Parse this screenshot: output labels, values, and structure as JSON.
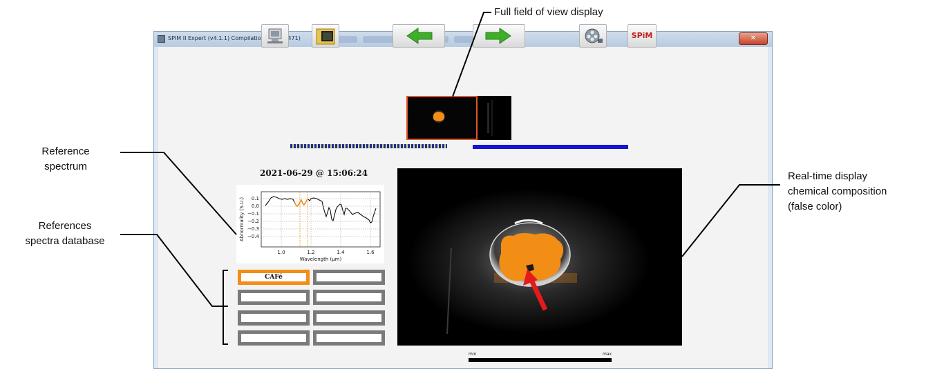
{
  "window": {
    "title": "SPIM II Expert  (v4.1.1) Compilation: 471 (b 471)",
    "close_glyph": "✕"
  },
  "toolbar": {
    "buttons": [
      {
        "name": "acquisition-icon"
      },
      {
        "name": "open-folder-icon"
      },
      {
        "name": "arrow-left-icon",
        "color": "#3fae29"
      },
      {
        "name": "arrow-right-icon",
        "color": "#3fae29"
      },
      {
        "name": "film-reel-icon"
      },
      {
        "name": "spim-logo",
        "label": "SPiM"
      }
    ]
  },
  "acquisition": {
    "timestamp": "2021-06-29 @ 15:06:24"
  },
  "spectrum_plot": {
    "ylabel": "Abnormality (S.U.)",
    "xlabel": "Wavelength (μm)",
    "yticks": [
      "0.1",
      "0.0",
      "−0.1",
      "−0.2",
      "−0.3",
      "−0.4"
    ],
    "xticks": [
      "1.0",
      "1.2",
      "1.4",
      "1.6"
    ]
  },
  "references": {
    "cells": [
      {
        "label": "CAFé",
        "active": true
      },
      {
        "label": "",
        "active": false
      },
      {
        "label": "",
        "active": false
      },
      {
        "label": "",
        "active": false
      },
      {
        "label": "",
        "active": false
      },
      {
        "label": "",
        "active": false
      },
      {
        "label": "",
        "active": false
      },
      {
        "label": "",
        "active": false
      }
    ]
  },
  "scale": {
    "min": "min",
    "max": "max"
  },
  "annotations": {
    "full_field": "Full field of view display",
    "reference_spectrum": [
      "Reference",
      "spectrum"
    ],
    "references_db": [
      "References",
      "spectra database"
    ],
    "realtime": [
      "Real-time display",
      "chemical composition",
      "(false color)"
    ]
  },
  "colors": {
    "highlight": "#f28d16",
    "thumb_border": "#e2562a",
    "nav_bar": "#1414d2",
    "spim_red": "#c0201b"
  }
}
